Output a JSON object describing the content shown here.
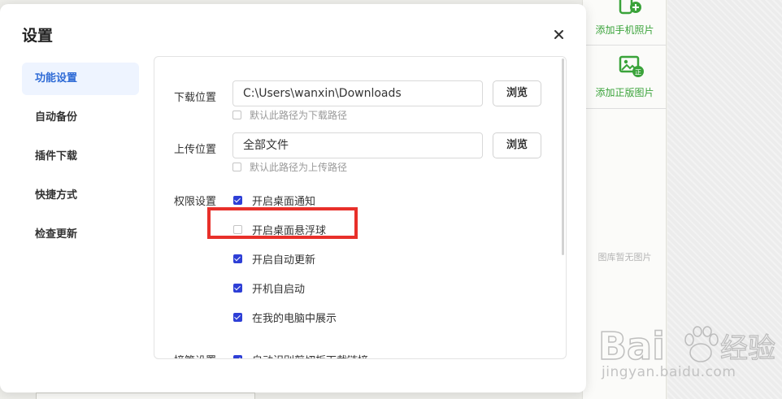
{
  "dialog": {
    "title": "设置",
    "close_label": "×"
  },
  "nav": {
    "items": [
      {
        "label": "功能设置",
        "active": true
      },
      {
        "label": "自动备份",
        "active": false
      },
      {
        "label": "插件下载",
        "active": false
      },
      {
        "label": "快捷方式",
        "active": false
      },
      {
        "label": "检查更新",
        "active": false
      }
    ]
  },
  "download": {
    "label": "下载位置",
    "path": "C:\\Users\\wanxin\\Downloads",
    "browse_label": "浏览",
    "default_checkbox_label": "默认此路径为下载路径",
    "default_checked": false
  },
  "upload": {
    "label": "上传位置",
    "path": "全部文件",
    "browse_label": "浏览",
    "default_checkbox_label": "默认此路径为上传路径",
    "default_checked": false
  },
  "permissions": {
    "label": "权限设置",
    "items": [
      {
        "label": "开启桌面通知",
        "checked": true
      },
      {
        "label": "开启桌面悬浮球",
        "checked": false
      },
      {
        "label": "开启自动更新",
        "checked": true
      },
      {
        "label": "开机自启动",
        "checked": true
      },
      {
        "label": "在我的电脑中展示",
        "checked": true
      }
    ]
  },
  "takeover": {
    "label": "接管设置",
    "items": [
      {
        "label": "自动识别剪切板下载链接",
        "checked": true
      }
    ]
  },
  "right_panel": {
    "add_phone_photo": "添加手机照片",
    "add_licensed_image": "添加正版图片",
    "empty_text": "图库暂无图片"
  },
  "watermark": {
    "brand_text": "Bai",
    "brand_suffix": "经验",
    "url": "jingyan.baidu.com"
  },
  "colors": {
    "accent_blue": "#2e3fd6",
    "nav_active_bg": "#eef4ff",
    "nav_active_text": "#2f6bd6",
    "green": "#3aa33a",
    "highlight_red": "#e8302a"
  }
}
